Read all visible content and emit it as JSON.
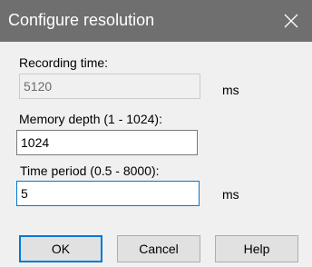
{
  "window": {
    "title": "Configure resolution",
    "close_icon": "close-icon"
  },
  "recording_time": {
    "label": "Recording time:",
    "value": "5120",
    "unit": "ms",
    "enabled": false
  },
  "memory_depth": {
    "label": "Memory depth (1 - 1024):",
    "value": "1024"
  },
  "time_period": {
    "label": "Time period (0.5 - 8000):",
    "value": "5",
    "unit": "ms"
  },
  "buttons": {
    "ok": "OK",
    "cancel": "Cancel",
    "help": "Help"
  }
}
